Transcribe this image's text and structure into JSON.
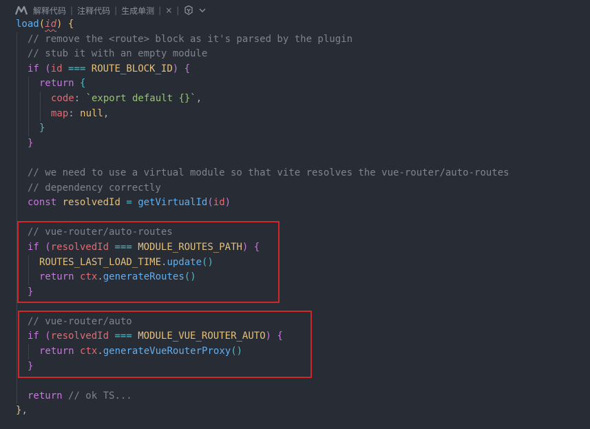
{
  "codelens": {
    "items": [
      "解释代码",
      "注释代码",
      "生成单测"
    ],
    "close_symbol": "×",
    "separator": "|",
    "logo_icon": "marscode-logo-icon",
    "brand_icon": "ai-assistant-icon",
    "chevron_icon": "chevron-down-icon"
  },
  "colors": {
    "background": "#282c34",
    "highlight_box": "#d0272d",
    "comment": "#7f848e",
    "keyword": "#c678dd",
    "function": "#61afef",
    "constant": "#e5c07b",
    "string": "#98c379",
    "variable": "#e06c75"
  },
  "code_lines": [
    {
      "indent": 0,
      "tokens": [
        [
          "fn",
          "load"
        ],
        [
          "b1",
          "("
        ],
        [
          "param",
          "id"
        ],
        [
          "b1",
          ")"
        ],
        [
          "plain",
          " "
        ],
        [
          "b1",
          "{"
        ]
      ]
    },
    {
      "indent": 1,
      "tokens": [
        [
          "cmt",
          "// remove the <route> block as it's parsed by the plugin"
        ]
      ]
    },
    {
      "indent": 1,
      "tokens": [
        [
          "cmt",
          "// stub it with an empty module"
        ]
      ]
    },
    {
      "indent": 1,
      "tokens": [
        [
          "kw",
          "if"
        ],
        [
          "plain",
          " "
        ],
        [
          "b2",
          "("
        ],
        [
          "var",
          "id"
        ],
        [
          "plain",
          " "
        ],
        [
          "op",
          "==="
        ],
        [
          "plain",
          " "
        ],
        [
          "const",
          "ROUTE_BLOCK_ID"
        ],
        [
          "b2",
          ")"
        ],
        [
          "plain",
          " "
        ],
        [
          "b2",
          "{"
        ]
      ]
    },
    {
      "indent": 2,
      "tokens": [
        [
          "kw",
          "return"
        ],
        [
          "plain",
          " "
        ],
        [
          "b3",
          "{"
        ]
      ]
    },
    {
      "indent": 3,
      "tokens": [
        [
          "prop",
          "code"
        ],
        [
          "plain",
          ": "
        ],
        [
          "str",
          "`export default {}`"
        ],
        [
          "plain",
          ","
        ]
      ]
    },
    {
      "indent": 3,
      "tokens": [
        [
          "prop",
          "map"
        ],
        [
          "plain",
          ": "
        ],
        [
          "const",
          "null"
        ],
        [
          "plain",
          ","
        ]
      ]
    },
    {
      "indent": 2,
      "tokens": [
        [
          "b3",
          "}"
        ]
      ]
    },
    {
      "indent": 1,
      "tokens": [
        [
          "b2",
          "}"
        ]
      ]
    },
    {
      "indent": 0,
      "tokens": []
    },
    {
      "indent": 1,
      "tokens": [
        [
          "cmt",
          "// we need to use a virtual module so that vite resolves the vue-router/auto-routes"
        ]
      ]
    },
    {
      "indent": 1,
      "tokens": [
        [
          "cmt",
          "// dependency correctly"
        ]
      ]
    },
    {
      "indent": 1,
      "tokens": [
        [
          "kw",
          "const"
        ],
        [
          "plain",
          " "
        ],
        [
          "const",
          "resolvedId"
        ],
        [
          "plain",
          " "
        ],
        [
          "op",
          "="
        ],
        [
          "plain",
          " "
        ],
        [
          "fn",
          "getVirtualId"
        ],
        [
          "b2",
          "("
        ],
        [
          "var",
          "id"
        ],
        [
          "b2",
          ")"
        ]
      ]
    },
    {
      "indent": 0,
      "tokens": []
    },
    {
      "indent": 1,
      "tokens": [
        [
          "cmt",
          "// vue-router/auto-routes"
        ]
      ]
    },
    {
      "indent": 1,
      "tokens": [
        [
          "kw",
          "if"
        ],
        [
          "plain",
          " "
        ],
        [
          "b2",
          "("
        ],
        [
          "var",
          "resolvedId"
        ],
        [
          "plain",
          " "
        ],
        [
          "op",
          "==="
        ],
        [
          "plain",
          " "
        ],
        [
          "const",
          "MODULE_ROUTES_PATH"
        ],
        [
          "b2",
          ")"
        ],
        [
          "plain",
          " "
        ],
        [
          "b2",
          "{"
        ]
      ]
    },
    {
      "indent": 2,
      "tokens": [
        [
          "const",
          "ROUTES_LAST_LOAD_TIME"
        ],
        [
          "plain",
          "."
        ],
        [
          "fn",
          "update"
        ],
        [
          "b3",
          "()"
        ]
      ]
    },
    {
      "indent": 2,
      "tokens": [
        [
          "kw",
          "return"
        ],
        [
          "plain",
          " "
        ],
        [
          "var",
          "ctx"
        ],
        [
          "plain",
          "."
        ],
        [
          "fn",
          "generateRoutes"
        ],
        [
          "b3",
          "()"
        ]
      ]
    },
    {
      "indent": 1,
      "tokens": [
        [
          "b2",
          "}"
        ]
      ]
    },
    {
      "indent": 0,
      "tokens": []
    },
    {
      "indent": 1,
      "tokens": [
        [
          "cmt",
          "// vue-router/auto"
        ]
      ]
    },
    {
      "indent": 1,
      "tokens": [
        [
          "kw",
          "if"
        ],
        [
          "plain",
          " "
        ],
        [
          "b2",
          "("
        ],
        [
          "var",
          "resolvedId"
        ],
        [
          "plain",
          " "
        ],
        [
          "op",
          "==="
        ],
        [
          "plain",
          " "
        ],
        [
          "const",
          "MODULE_VUE_ROUTER_AUTO"
        ],
        [
          "b2",
          ")"
        ],
        [
          "plain",
          " "
        ],
        [
          "b2",
          "{"
        ]
      ]
    },
    {
      "indent": 2,
      "tokens": [
        [
          "kw",
          "return"
        ],
        [
          "plain",
          " "
        ],
        [
          "var",
          "ctx"
        ],
        [
          "plain",
          "."
        ],
        [
          "fn",
          "generateVueRouterProxy"
        ],
        [
          "b3",
          "()"
        ]
      ]
    },
    {
      "indent": 1,
      "tokens": [
        [
          "b2",
          "}"
        ]
      ]
    },
    {
      "indent": 0,
      "tokens": []
    },
    {
      "indent": 1,
      "tokens": [
        [
          "kw",
          "return"
        ],
        [
          "plain",
          " "
        ],
        [
          "cmt",
          "// ok TS..."
        ]
      ]
    },
    {
      "indent": 0,
      "tokens": [
        [
          "b1",
          "}"
        ],
        [
          "plain",
          ","
        ]
      ]
    }
  ],
  "highlight_boxes": [
    {
      "label": "auto-routes-block",
      "first_line": 14,
      "last_line": 18
    },
    {
      "label": "auto-block",
      "first_line": 20,
      "last_line": 23
    }
  ]
}
